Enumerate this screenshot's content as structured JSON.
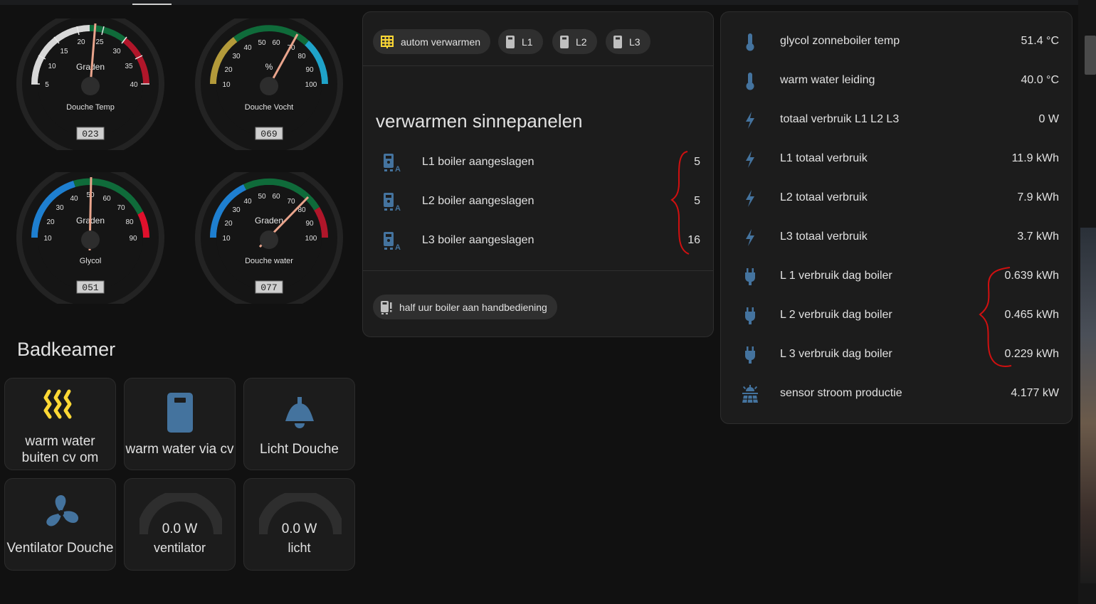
{
  "gauges": [
    {
      "id": "douche-temp",
      "title": "Graden",
      "label": "Douche Temp",
      "value": "023",
      "ticks": [
        "5",
        "10",
        "15",
        "20",
        "25",
        "30",
        "35",
        "40"
      ]
    },
    {
      "id": "douche-vocht",
      "title": "%",
      "label": "Douche Vocht",
      "value": "069",
      "ticks": [
        "10",
        "20",
        "30",
        "40",
        "50",
        "60",
        "70",
        "80",
        "90",
        "100"
      ]
    },
    {
      "id": "glycol",
      "title": "Graden",
      "label": "Glycol",
      "value": "051",
      "ticks": [
        "10",
        "20",
        "30",
        "40",
        "50",
        "60",
        "70",
        "80",
        "90"
      ]
    },
    {
      "id": "douche-water",
      "title": "Graden",
      "label": "Douche water",
      "value": "077",
      "ticks": [
        "10",
        "20",
        "30",
        "40",
        "50",
        "60",
        "70",
        "80",
        "90",
        "100"
      ]
    }
  ],
  "section": {
    "title": "Badkeamer"
  },
  "tiles": [
    {
      "label": "warm water buiten cv om",
      "icon": "radiator-heat-icon"
    },
    {
      "label": "warm water via cv",
      "icon": "water-boiler-icon"
    },
    {
      "label": "Licht Douche",
      "icon": "ceiling-light-icon"
    },
    {
      "label": "Ventilator Douche",
      "icon": "fan-icon"
    },
    {
      "label": "ventilator",
      "value": "0.0 W",
      "icon": "power-gauge"
    },
    {
      "label": "licht",
      "value": "0.0 W",
      "icon": "power-gauge"
    }
  ],
  "middle_card": {
    "chips": [
      "autom verwarmen",
      "L1",
      "L2",
      "L3"
    ],
    "title": "verwarmen sinnepanelen",
    "rows": [
      {
        "name": "L1 boiler aangeslagen",
        "value": "5"
      },
      {
        "name": "L2 boiler aangeslagen",
        "value": "5"
      },
      {
        "name": "L3 boiler aangeslagen",
        "value": "16"
      }
    ],
    "footer_chip": "half uur boiler aan handbediening"
  },
  "right_card": {
    "rows": [
      {
        "name": "glycol zonneboiler temp",
        "value": "51.4 °C",
        "icon": "thermometer-icon"
      },
      {
        "name": "warm water leiding",
        "value": "40.0 °C",
        "icon": "thermometer-icon"
      },
      {
        "name": "totaal verbruik L1 L2 L3",
        "value": "0 W",
        "icon": "lightning-icon"
      },
      {
        "name": "L1 totaal verbruik",
        "value": "11.9 kWh",
        "icon": "lightning-icon"
      },
      {
        "name": "L2 totaal verbruik",
        "value": "7.9 kWh",
        "icon": "lightning-icon"
      },
      {
        "name": "L3 totaal verbruik",
        "value": "3.7 kWh",
        "icon": "lightning-icon"
      },
      {
        "name": "L 1 verbruik dag boiler",
        "value": "0.639 kWh",
        "icon": "power-plug-icon"
      },
      {
        "name": "L 2 verbruik dag boiler",
        "value": "0.465 kWh",
        "icon": "power-plug-icon"
      },
      {
        "name": "L 3 verbruik dag boiler",
        "value": "0.229 kWh",
        "icon": "power-plug-icon"
      },
      {
        "name": "sensor stroom productie",
        "value": "4.177 kW",
        "icon": "solar-power-icon"
      }
    ]
  },
  "colors": {
    "accent_blue": "#44739e",
    "accent_yellow": "#fdd835",
    "annotation_red": "#d01010"
  }
}
